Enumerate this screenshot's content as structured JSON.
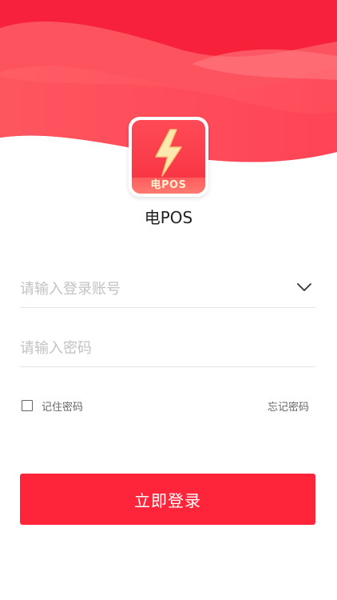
{
  "app": {
    "name": "电POS",
    "badge": "电POS"
  },
  "form": {
    "account_placeholder": "请输入登录账号",
    "password_placeholder": "请输入密码"
  },
  "options": {
    "remember_label": "记住密码",
    "remember_checked": false,
    "forgot_label": "忘记密码"
  },
  "actions": {
    "login_label": "立即登录"
  },
  "icons": {
    "dropdown": "chevron-down-icon",
    "logo": "lightning-bolt-icon"
  },
  "colors": {
    "primary": "#fe2439",
    "hero_dark": "#f6203a",
    "hero_light": "#ff6b70",
    "text_muted": "#c2c2c2"
  }
}
